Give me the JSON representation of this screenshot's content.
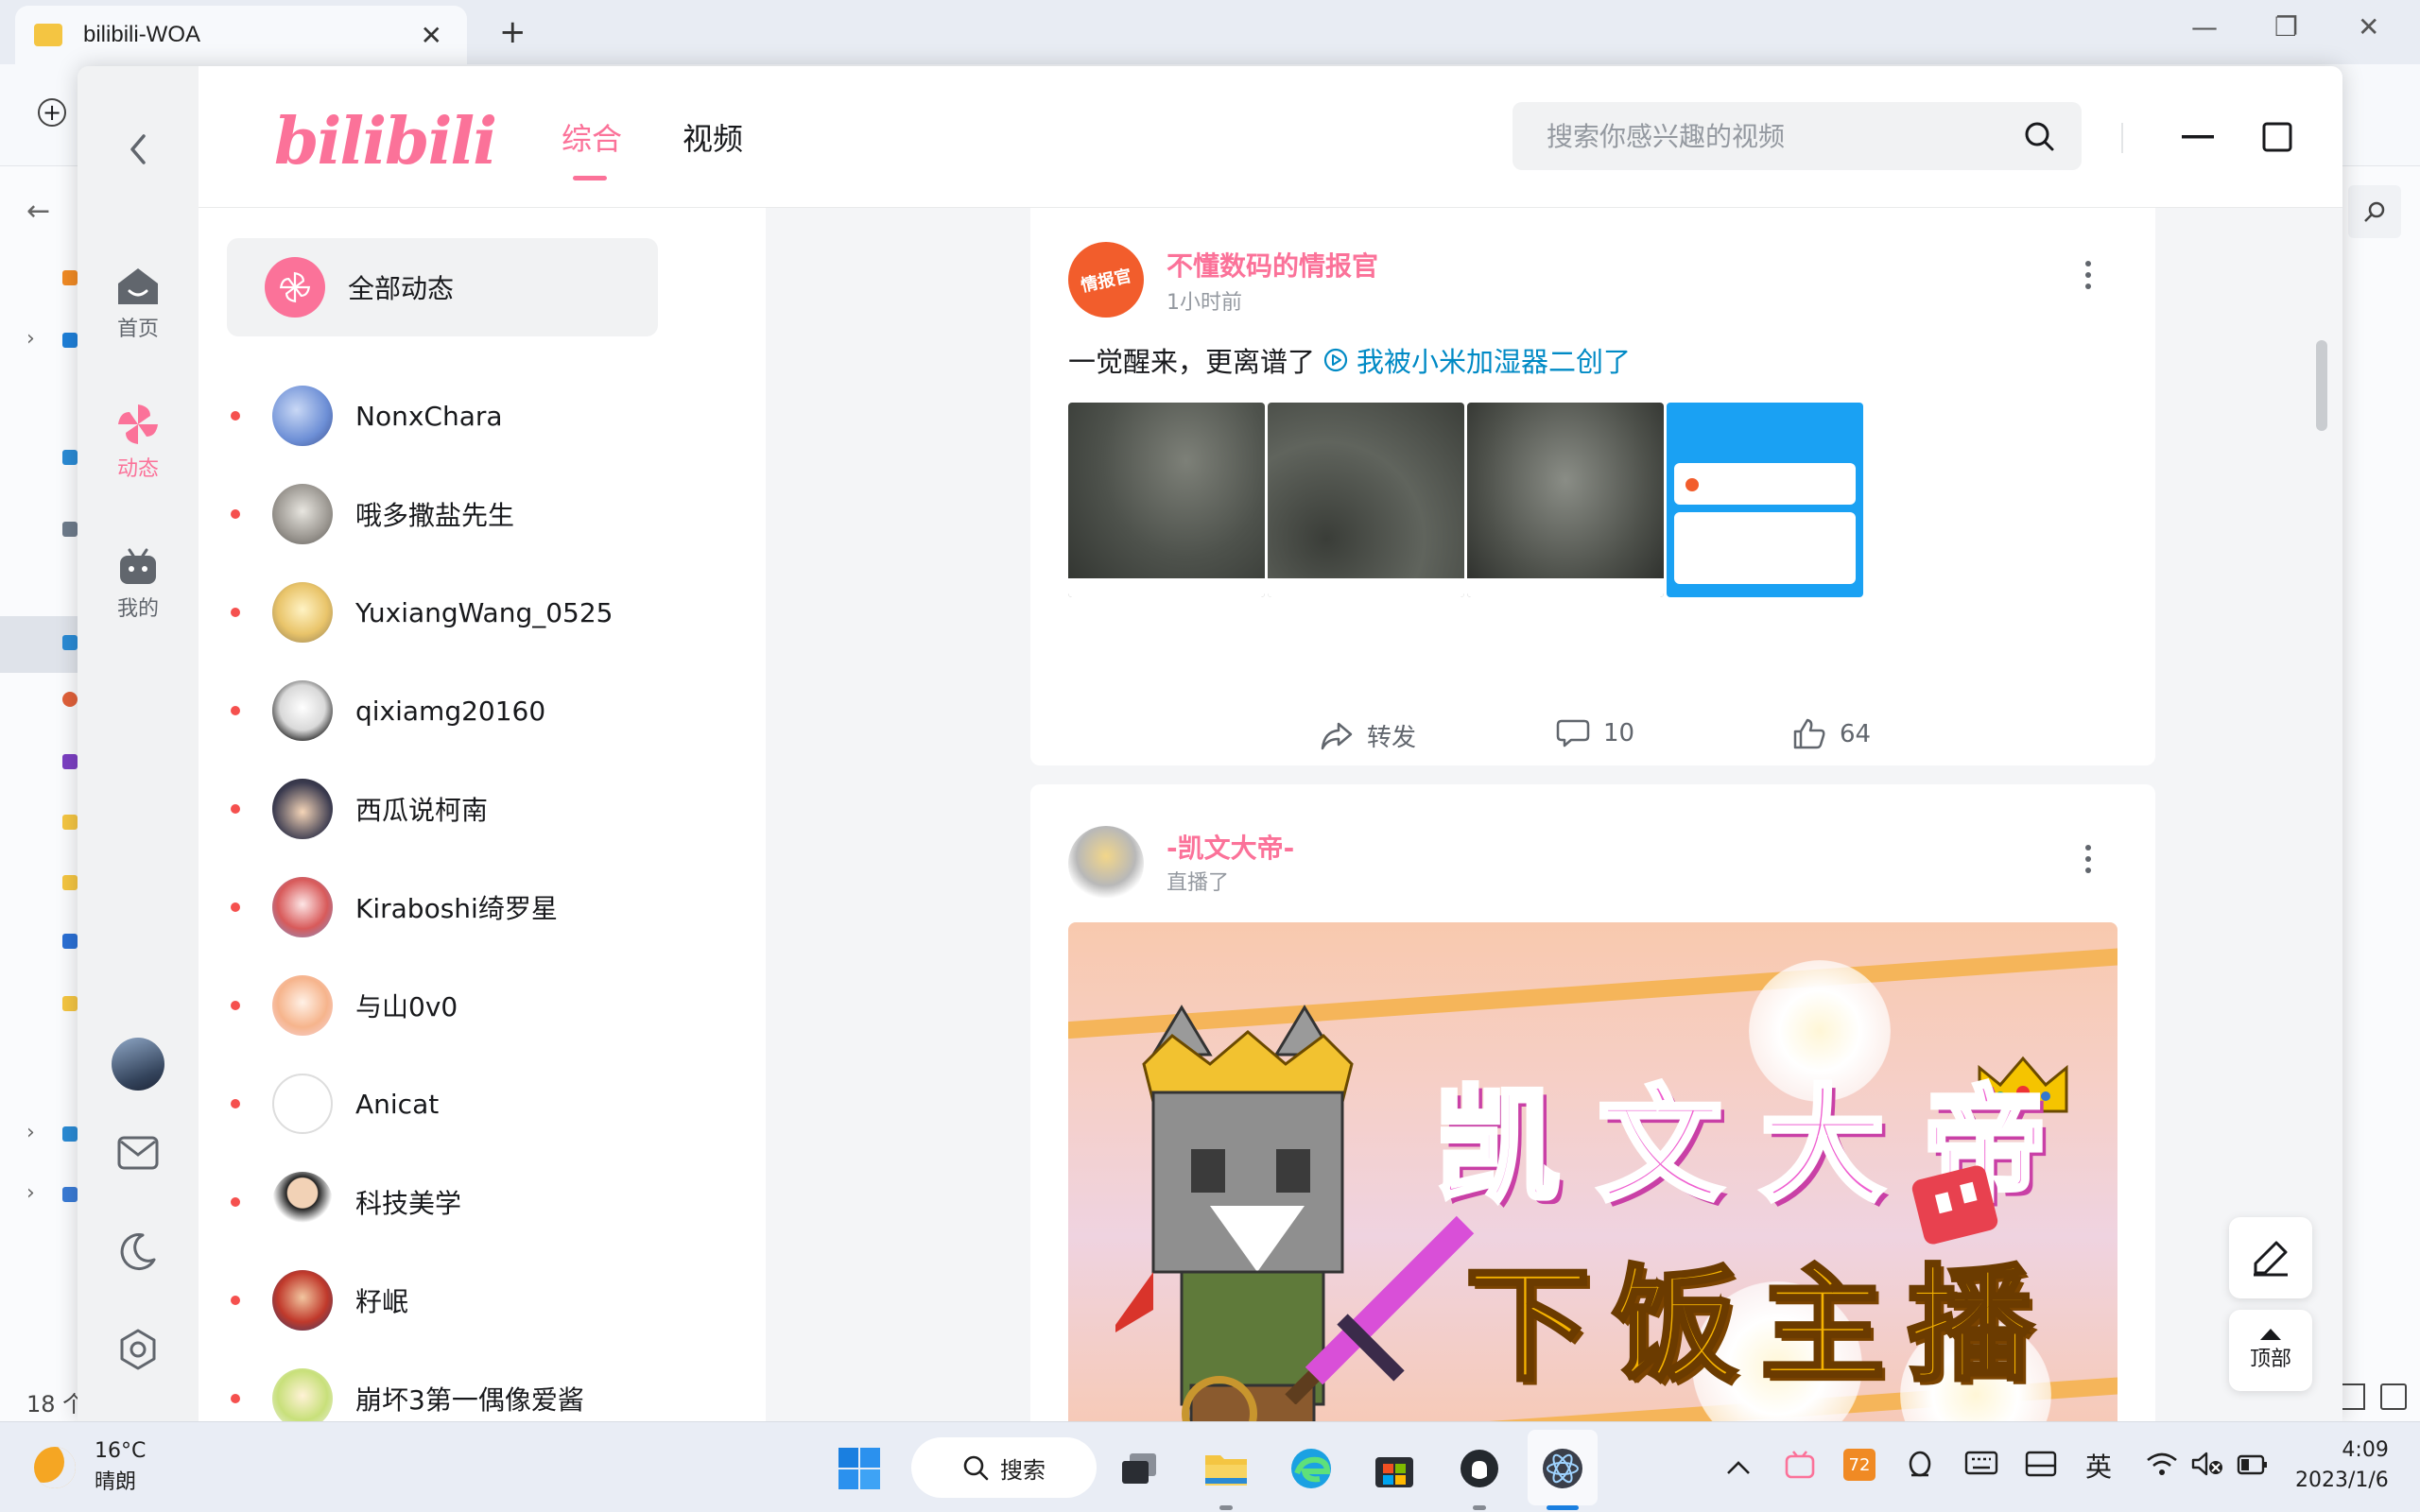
{
  "background_window": {
    "tab_title": "bilibili-WOA",
    "status_count": "18 个"
  },
  "app": {
    "logo_text": "bilibili",
    "nav_tabs": [
      {
        "label": "综合",
        "active": true
      },
      {
        "label": "视频",
        "active": false
      }
    ],
    "search": {
      "placeholder": "搜索你感兴趣的视频",
      "value": ""
    },
    "rail": [
      {
        "label": "首页",
        "icon": "tv-home-icon",
        "active": false
      },
      {
        "label": "动态",
        "icon": "pinwheel-icon",
        "active": true
      },
      {
        "label": "我的",
        "icon": "tv-user-icon",
        "active": false
      }
    ],
    "accent_color": "#fb7299"
  },
  "sidebar": {
    "all_label": "全部动态",
    "ups": [
      {
        "name": "NonxChara"
      },
      {
        "name": "哦多撒盐先生"
      },
      {
        "name": "YuxiangWang_0525"
      },
      {
        "name": "qixiamg20160"
      },
      {
        "name": "西瓜说柯南"
      },
      {
        "name": "Kiraboshi绮罗星"
      },
      {
        "name": "与山0v0"
      },
      {
        "name": "Anicat"
      },
      {
        "name": "科技美学"
      },
      {
        "name": "籽岷"
      },
      {
        "name": "崩坏3第一偶像爱酱"
      }
    ]
  },
  "feed": [
    {
      "author": "不懂数码的情报官",
      "avatar_text": "情报官",
      "time": "1小时前",
      "text": "一觉醒来，更离谱了",
      "link_text": "我被小米加湿器二创了",
      "actions": {
        "forward": "转发",
        "comments": "10",
        "likes": "64"
      }
    },
    {
      "author": "-凯文大帝-",
      "time": "直播了",
      "banner_line1": "凯文大帝",
      "banner_line2": "下饭主播"
    }
  ],
  "fab": {
    "top_label": "顶部"
  },
  "taskbar": {
    "temp": "16°C",
    "condition": "晴朗",
    "search_label": "搜索",
    "tray_badge": "72",
    "ime": "英",
    "time": "4:09",
    "date": "2023/1/6"
  }
}
